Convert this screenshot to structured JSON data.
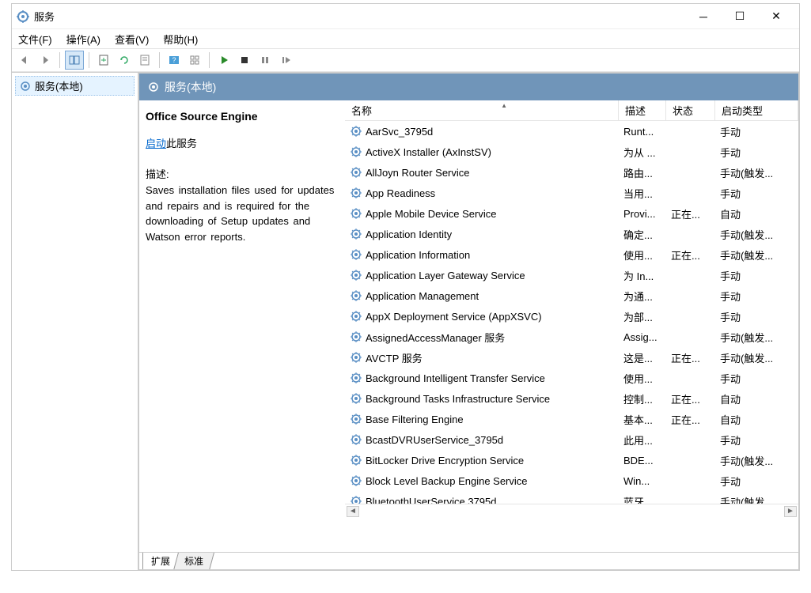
{
  "window": {
    "title": "服务"
  },
  "menu": {
    "file": "文件(F)",
    "action": "操作(A)",
    "view": "查看(V)",
    "help": "帮助(H)"
  },
  "leftPane": {
    "item": "服务(本地)"
  },
  "rightHeader": "服务(本地)",
  "detail": {
    "name": "Office  Source Engine",
    "startLink": "启动",
    "startLinkSuffix": "此服务",
    "descLabel": "描述:",
    "descText": "Saves installation files used for updates and repairs and is required for the downloading of Setup updates and Watson error reports."
  },
  "columns": {
    "name": "名称",
    "desc": "描述",
    "status": "状态",
    "startup": "启动类型"
  },
  "tabs": {
    "extended": "扩展",
    "standard": "标准"
  },
  "services": [
    {
      "name": "AarSvc_3795d",
      "desc": "Runt...",
      "status": "",
      "startup": "手动"
    },
    {
      "name": "ActiveX Installer (AxInstSV)",
      "desc": "为从 ...",
      "status": "",
      "startup": "手动"
    },
    {
      "name": "AllJoyn Router Service",
      "desc": "路由...",
      "status": "",
      "startup": "手动(触发..."
    },
    {
      "name": "App Readiness",
      "desc": "当用...",
      "status": "",
      "startup": "手动"
    },
    {
      "name": "Apple Mobile Device Service",
      "desc": "Provi...",
      "status": "正在...",
      "startup": "自动"
    },
    {
      "name": "Application Identity",
      "desc": "确定...",
      "status": "",
      "startup": "手动(触发..."
    },
    {
      "name": "Application Information",
      "desc": "使用...",
      "status": "正在...",
      "startup": "手动(触发..."
    },
    {
      "name": "Application Layer Gateway Service",
      "desc": "为 In...",
      "status": "",
      "startup": "手动"
    },
    {
      "name": "Application Management",
      "desc": "为通...",
      "status": "",
      "startup": "手动"
    },
    {
      "name": "AppX Deployment Service (AppXSVC)",
      "desc": "为部...",
      "status": "",
      "startup": "手动"
    },
    {
      "name": "AssignedAccessManager 服务",
      "desc": "Assig...",
      "status": "",
      "startup": "手动(触发..."
    },
    {
      "name": "AVCTP 服务",
      "desc": "这是...",
      "status": "正在...",
      "startup": "手动(触发..."
    },
    {
      "name": "Background Intelligent Transfer Service",
      "desc": "使用...",
      "status": "",
      "startup": "手动"
    },
    {
      "name": "Background Tasks Infrastructure Service",
      "desc": "控制...",
      "status": "正在...",
      "startup": "自动"
    },
    {
      "name": "Base Filtering Engine",
      "desc": "基本...",
      "status": "正在...",
      "startup": "自动"
    },
    {
      "name": "BcastDVRUserService_3795d",
      "desc": "此用...",
      "status": "",
      "startup": "手动"
    },
    {
      "name": "BitLocker Drive Encryption Service",
      "desc": "BDE...",
      "status": "",
      "startup": "手动(触发..."
    },
    {
      "name": "Block Level Backup Engine Service",
      "desc": "Win...",
      "status": "",
      "startup": "手动"
    },
    {
      "name": "BluetoothUserService 3795d",
      "desc": "蓝牙...",
      "status": "",
      "startup": "手动(触发..."
    }
  ]
}
